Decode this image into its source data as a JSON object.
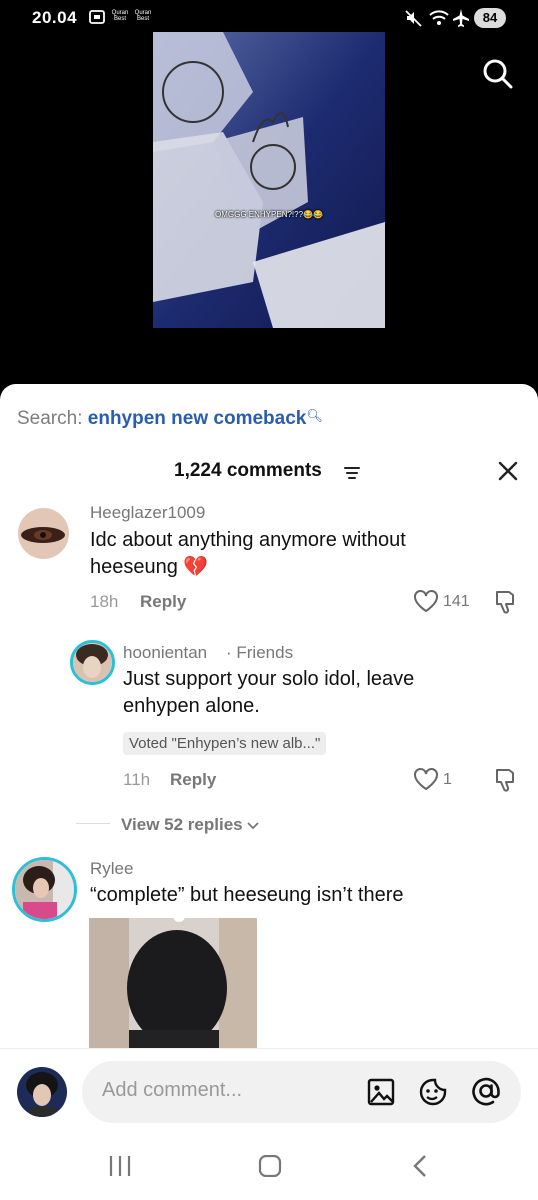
{
  "status_bar": {
    "time": "20.04",
    "notif_1": "Quran Best",
    "notif_2": "Quran Best",
    "battery": "84"
  },
  "video": {
    "caption": "OMGGG ENHYPEN?!??😂😂"
  },
  "search": {
    "label": "Search:",
    "term": "enhypen new comeback"
  },
  "comments_header": {
    "count": "1,224 comments"
  },
  "comments": [
    {
      "username": "Heeglazer1009",
      "text": "Idc about anything anymore without heeseung 💔",
      "time": "18h",
      "reply_label": "Reply",
      "likes": "141"
    },
    {
      "username": "hoonientan",
      "badge": "· Friends",
      "text": "Just support your solo idol, leave enhypen alone.",
      "vote": "Voted \"Enhypen’s new alb...\"",
      "time": "11h",
      "reply_label": "Reply",
      "likes": "1"
    },
    {
      "username": "Rylee",
      "text": "“complete” but heeseung isn’t there"
    }
  ],
  "view_replies": "View 52 replies",
  "composer": {
    "placeholder": "Add comment..."
  },
  "colors": {
    "accent": "#2a5db0",
    "story_ring": "#2bc0d6"
  }
}
